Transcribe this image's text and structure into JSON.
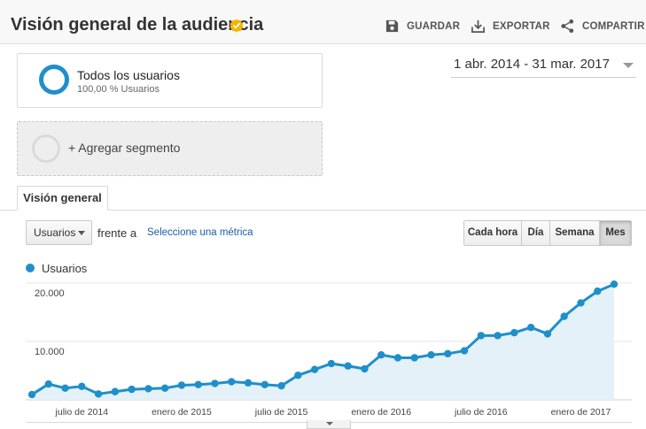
{
  "header": {
    "title": "Visión general de la audiencia",
    "save_label": "GUARDAR",
    "export_label": "EXPORTAR",
    "share_label": "COMPARTIR"
  },
  "segment": {
    "name": "Todos los usuarios",
    "percent": "100,00 % Usuarios"
  },
  "add_segment": {
    "label": "+ Agregar segmento"
  },
  "date_range": {
    "label": "1 abr. 2014 - 31 mar. 2017"
  },
  "tabs": [
    {
      "label": "Visión general"
    }
  ],
  "controls": {
    "metric_select": "Usuarios",
    "versus": "frente a",
    "pick_metric": "Seleccione una métrica",
    "periods": [
      "Cada hora",
      "Día",
      "Semana",
      "Mes"
    ],
    "active_period": "Mes"
  },
  "colors": {
    "series": "#1f8fc9",
    "area": "#e4f1f8",
    "verified": "#f5b400"
  },
  "chart_data": {
    "type": "area",
    "legend": [
      "Usuarios"
    ],
    "yticks": [
      "20.000",
      "10.000"
    ],
    "ytick_values": [
      20000,
      10000
    ],
    "ylim": [
      0,
      20000
    ],
    "xticks": [
      "julio de 2014",
      "enero de 2015",
      "julio de 2015",
      "enero de 2016",
      "julio de 2016",
      "enero de 2017"
    ],
    "xtick_index": [
      3,
      9,
      15,
      21,
      27,
      33
    ],
    "series": [
      {
        "name": "Usuarios",
        "values": [
          900,
          2700,
          2000,
          2300,
          1000,
          1400,
          1800,
          1900,
          2000,
          2500,
          2600,
          2800,
          3100,
          2900,
          2600,
          2400,
          4200,
          5200,
          6200,
          5800,
          5300,
          7700,
          7200,
          7200,
          7700,
          7900,
          8400,
          11000,
          11000,
          11500,
          12400,
          11300,
          14300,
          16600,
          18600,
          19800
        ]
      }
    ]
  }
}
